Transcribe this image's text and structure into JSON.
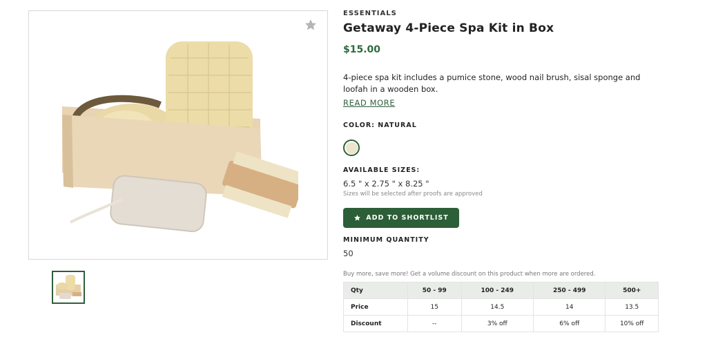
{
  "product": {
    "category": "ESSENTIALS",
    "title": "Getaway 4-Piece Spa Kit in Box",
    "price": "$15.00",
    "description": "4-piece spa kit includes a pumice stone, wood nail brush, sisal sponge and loofah in a wooden box.",
    "read_more": "READ MORE"
  },
  "color": {
    "label": "COLOR: NATURAL",
    "swatch_hex": "#ece4cc"
  },
  "sizes": {
    "label": "AVAILABLE SIZES:",
    "value": "6.5 \" x 2.75 \" x 8.25 \"",
    "note": "Sizes will be selected after proofs are approved"
  },
  "shortlist": {
    "label": "ADD TO SHORTLIST",
    "icon": "star-icon"
  },
  "minimum": {
    "label": "MINIMUM QUANTITY",
    "value": "50"
  },
  "discount_note": "Buy more, save more! Get a volume discount on this product when more are ordered.",
  "pricing_table": {
    "header": [
      "Qty",
      "50 - 99",
      "100 - 249",
      "250 - 499",
      "500+"
    ],
    "rows": [
      [
        "Price",
        "15",
        "14.5",
        "14",
        "13.5"
      ],
      [
        "Discount",
        "--",
        "3% off",
        "6% off",
        "10% off"
      ]
    ]
  },
  "icons": {
    "favorite": "star-icon"
  },
  "colors": {
    "accent": "#2c5e37",
    "price": "#2e6b3d"
  }
}
